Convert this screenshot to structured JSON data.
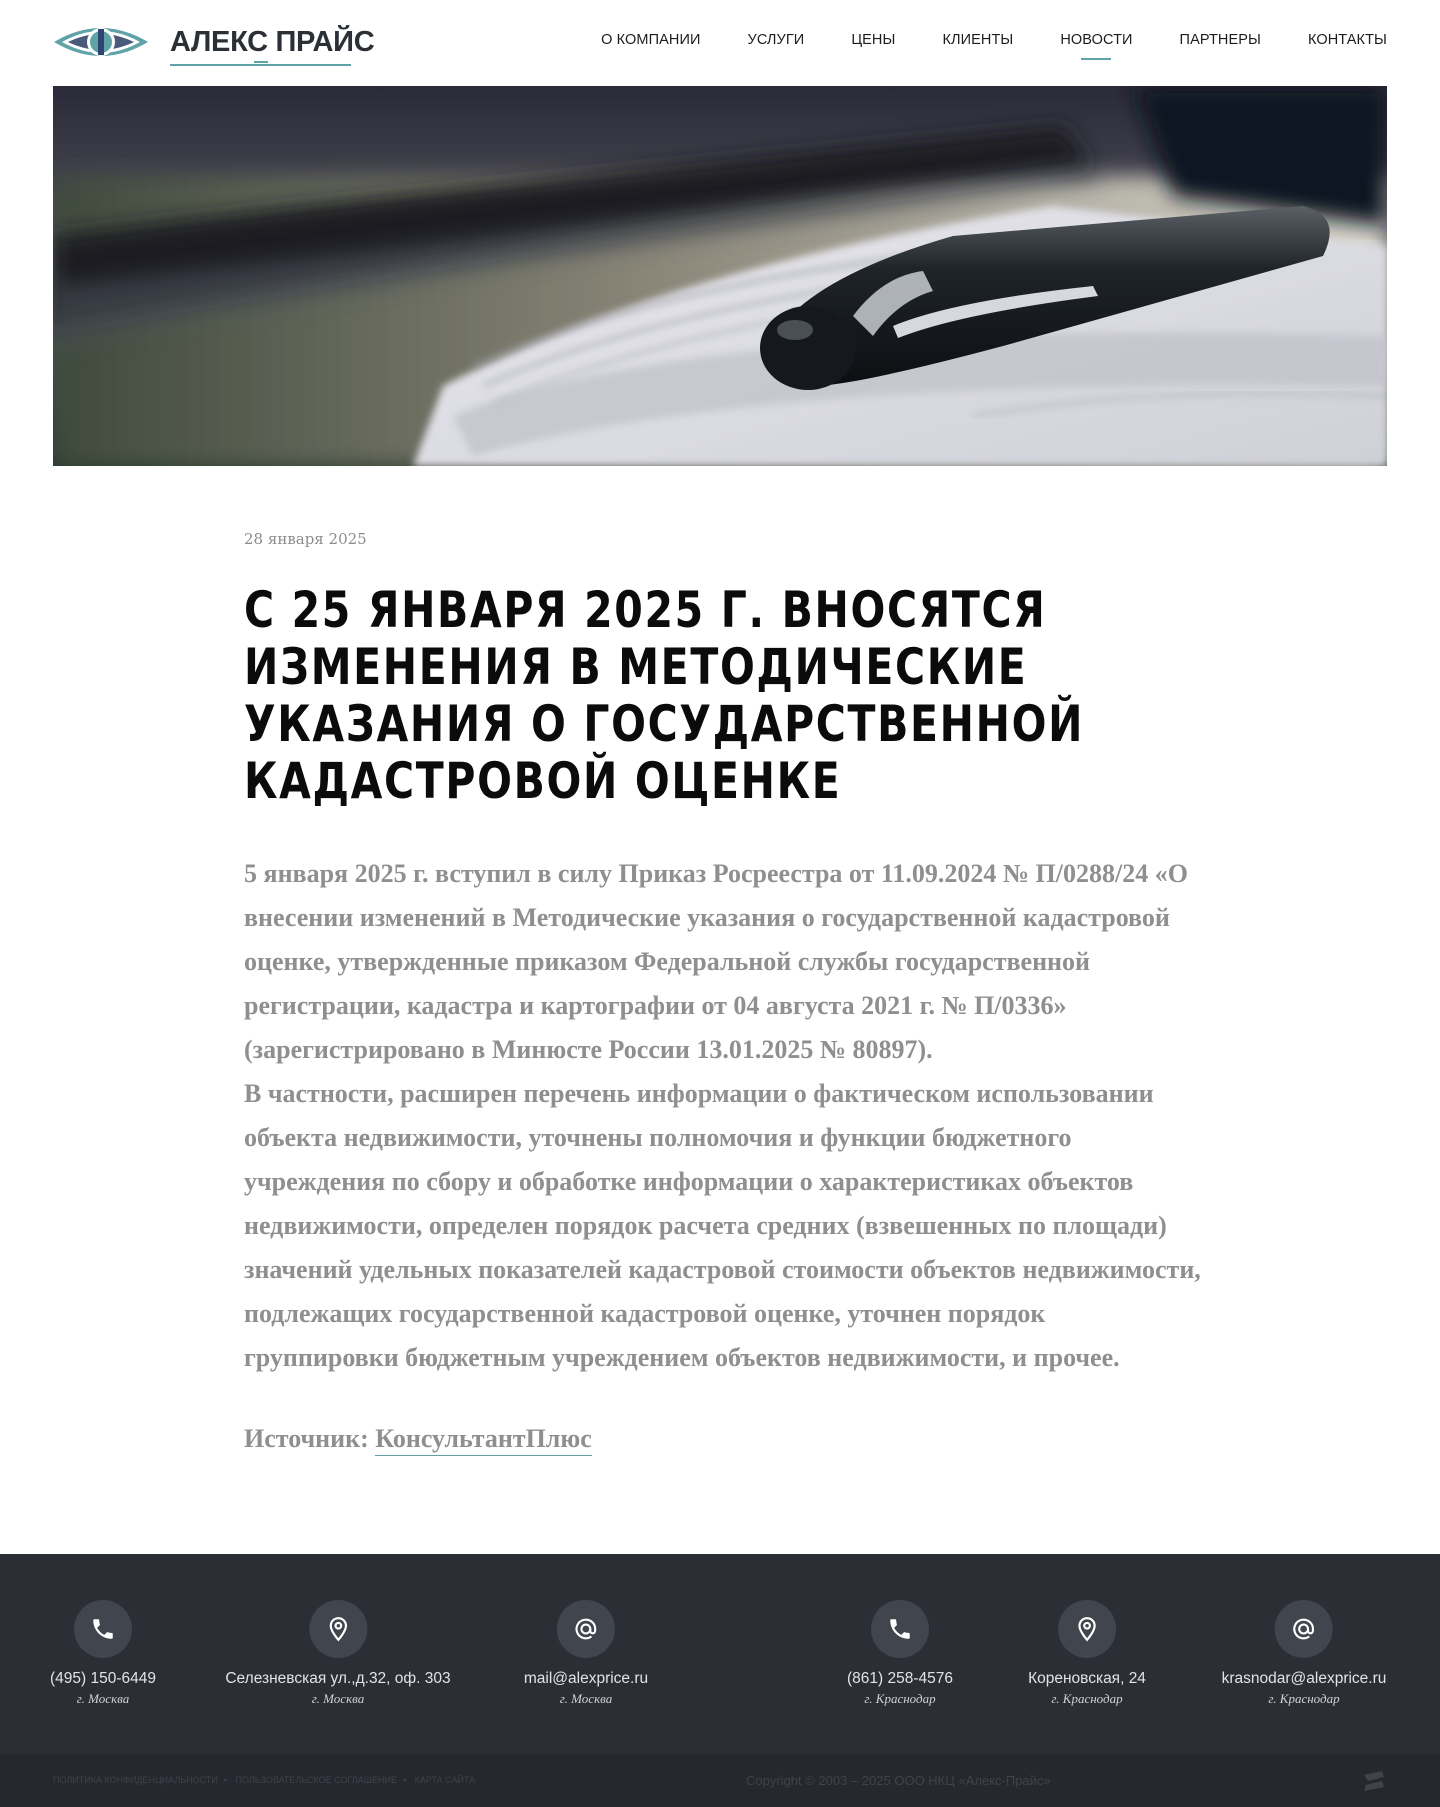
{
  "brand": {
    "name": "АЛЕКС ПРАЙС",
    "colors": {
      "accent": "#5fa3a8",
      "dark": "#2b2f36",
      "footer": "#2b2e35"
    }
  },
  "nav": {
    "items": [
      {
        "label": "О КОМПАНИИ"
      },
      {
        "label": "УСЛУГИ"
      },
      {
        "label": "ЦЕНЫ"
      },
      {
        "label": "КЛИЕНТЫ"
      },
      {
        "label": "НОВОСТИ",
        "active": true
      },
      {
        "label": "ПАРТНЕРЫ"
      },
      {
        "label": "КОНТАКТЫ"
      }
    ]
  },
  "hero": {
    "icon": "pen-notebook-photo"
  },
  "article": {
    "date": "28 января 2025",
    "title": "С 25 января 2025 г. вносятся изменения в Методические указания о государственной кадастровой оценке",
    "paragraph1": "5 января 2025 г. вступил в силу Приказ Росреестра от 11.09.2024 № П/0288/24 «О внесении изменений в Методические указания о государственной кадастровой оценке, утвержденные приказом Федеральной службы государственной регистрации, кадастра и картографии от 04 августа 2021 г. № П/0336» (зарегистрировано в Минюсте России 13.01.2025 № 80897).",
    "paragraph2": "В частности, расширен перечень информации о фактическом использовании объекта недвижимости, уточнены полномочия и функции бюджетного учреждения по сбору и обработке информации о характеристиках объектов недвижимости, определен порядок расчета средних (взвешенных по площади) значений удельных показателей кадастровой стоимости объектов недвижимости, подлежащих государственной кадастровой оценке, уточнен порядок группировки бюджетным учреждением объектов недвижимости, и прочее.",
    "source_label": "Источник:",
    "source_link": "КонсультантПлюс"
  },
  "footer": {
    "contacts": [
      {
        "icon": "phone-icon",
        "value": "(495) 150-6449",
        "city": "г. Москва"
      },
      {
        "icon": "location-pin-icon",
        "value": "Селезневская ул.,д.32, оф. 303",
        "city": "г. Москва"
      },
      {
        "icon": "at-sign-icon",
        "value": "mail@alexprice.ru",
        "city": "г. Москва"
      },
      {
        "icon": "phone-icon",
        "value": "(861) 258-4576",
        "city": "г. Краснодар"
      },
      {
        "icon": "location-pin-icon",
        "value": "Кореновская, 24",
        "city": "г. Краснодар"
      },
      {
        "icon": "at-sign-icon",
        "value": "krasnodar@alexprice.ru",
        "city": "г. Краснодар"
      }
    ]
  },
  "subfooter": {
    "links": [
      "ПОЛИТИКА КОНФИДЕНЦИАЛЬНОСТИ",
      "ПОЛЬЗОВАТЕЛЬСКОЕ СОГЛАШЕНИЕ",
      "КАРТА САЙТА"
    ],
    "copyright": "Copyright © 2003 – 2025 ООО НКЦ «Алекс-Прайс»"
  }
}
